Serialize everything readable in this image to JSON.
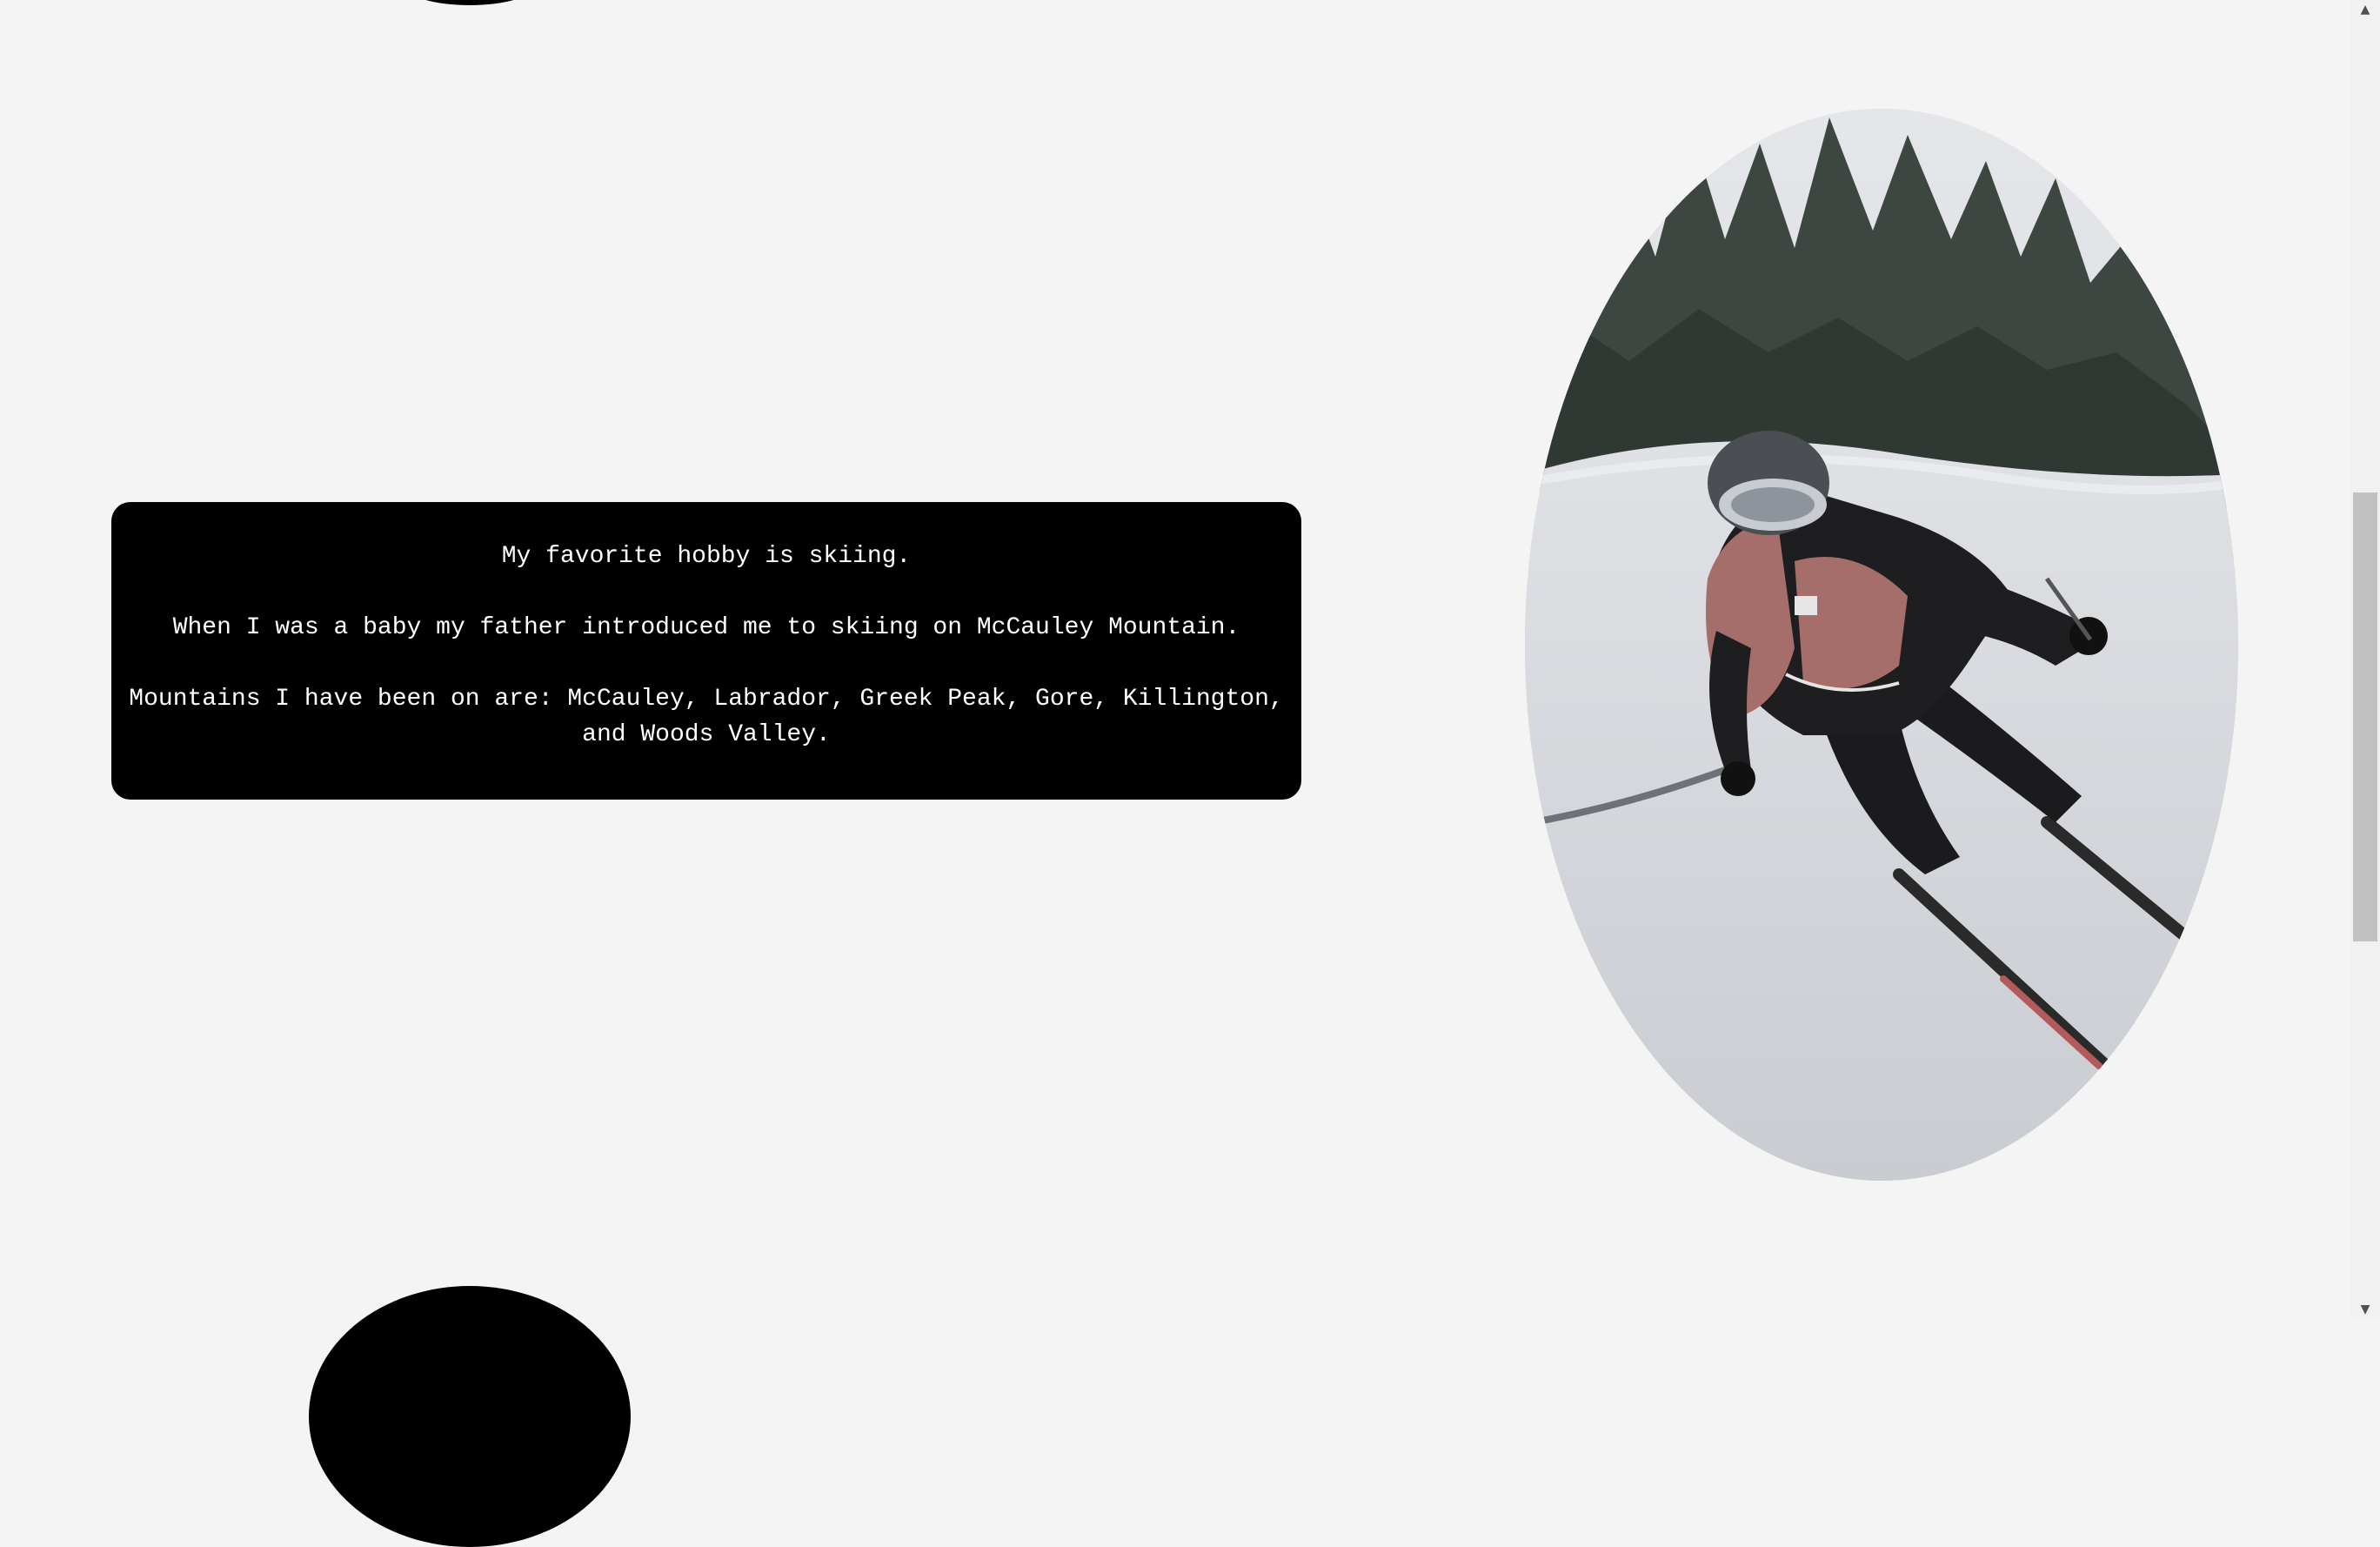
{
  "hobby": {
    "line1": "My favorite hobby is skiing.",
    "line2": "When I was a baby my father introduced me to skiing on McCauley Mountain.",
    "line3": "Mountains I have been on are: McCauley, Labrador, Greek Peak, Gore, Killington, and Woods Valley."
  },
  "photo": {
    "subject": "skier-carving-turn"
  },
  "scrollbar": {
    "up_arrow": "▲",
    "down_arrow": "▼"
  },
  "colors": {
    "page_background": "#f4f4f4",
    "card_background": "#000000",
    "card_text": "#ffffff"
  }
}
